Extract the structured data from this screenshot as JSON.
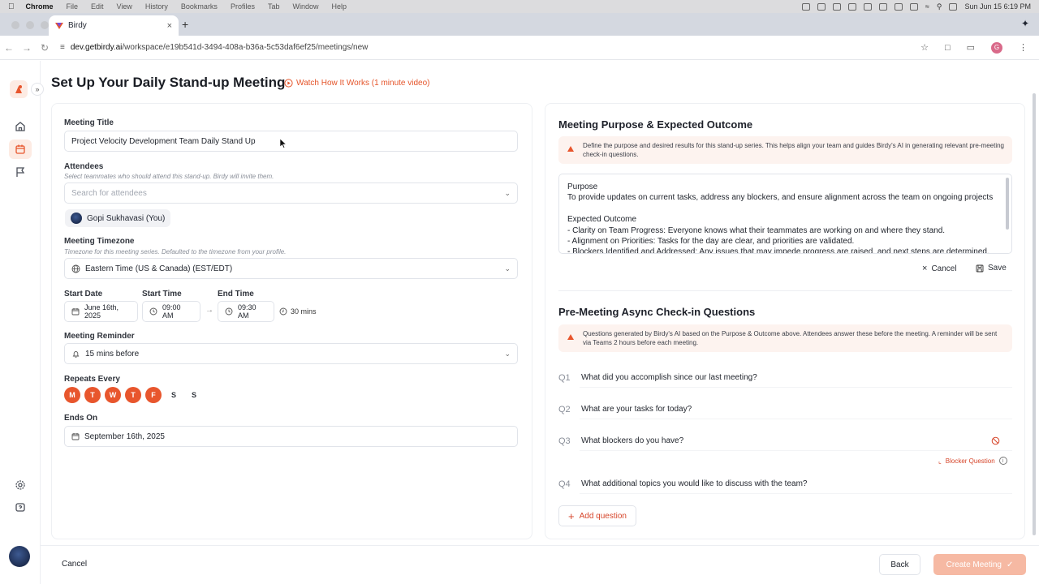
{
  "menubar": {
    "app": "Chrome",
    "items": [
      "File",
      "Edit",
      "View",
      "History",
      "Bookmarks",
      "Profiles",
      "Tab",
      "Window",
      "Help"
    ],
    "clock": "Sun Jun 15  6:19 PM"
  },
  "browser": {
    "tab_title": "Birdy",
    "url_host": "dev.getbirdy.ai",
    "url_path": "/workspace/e19b541d-3494-408a-b36a-5c53daf6ef25/meetings/new",
    "profile_initial": "G"
  },
  "page": {
    "title": "Set Up Your Daily Stand-up Meeting",
    "watch_link": "Watch How It Works (1 minute video)"
  },
  "form": {
    "meeting_title_label": "Meeting Title",
    "meeting_title_value": "Project Velocity Development Team Daily Stand Up",
    "attendees_label": "Attendees",
    "attendees_hint": "Select teammates who should attend this stand-up. Birdy will invite them.",
    "attendees_placeholder": "Search for attendees",
    "attendee_chip": "Gopi Sukhavasi (You)",
    "timezone_label": "Meeting Timezone",
    "timezone_hint": "Timezone for this meeting series. Defaulted to the timezone from your profile.",
    "timezone_value": "Eastern Time (US & Canada) (EST/EDT)",
    "start_date_label": "Start Date",
    "start_date_value": "June 16th, 2025",
    "start_time_label": "Start Time",
    "start_time_value": "09:00 AM",
    "end_time_label": "End Time",
    "end_time_value": "09:30 AM",
    "duration": "30 mins",
    "reminder_label": "Meeting Reminder",
    "reminder_value": "15 mins before",
    "repeats_label": "Repeats Every",
    "days": [
      "M",
      "T",
      "W",
      "T",
      "F",
      "S",
      "S"
    ],
    "days_selected": [
      true,
      true,
      true,
      true,
      true,
      false,
      false
    ],
    "ends_on_label": "Ends On",
    "ends_on_value": "September 16th, 2025"
  },
  "purpose": {
    "title": "Meeting Purpose & Expected Outcome",
    "note": "Define the purpose and desired results for this stand-up series. This helps align your team and guides Birdy's AI in generating relevant pre-meeting check-in questions.",
    "lines": [
      "Purpose",
      "To provide updates on current tasks, address any blockers, and ensure alignment across the team on ongoing projects",
      "",
      "Expected Outcome",
      "- Clarity on Team Progress: Everyone knows what their teammates are working on and where they stand.",
      "- Alignment on Priorities: Tasks for the day are clear, and priorities are validated.",
      "- Blockers Identified and Addressed: Any issues that may impede progress are raised, and next steps are determined."
    ],
    "cancel": "Cancel",
    "save": "Save"
  },
  "checkin": {
    "title": "Pre-Meeting Async Check-in Questions",
    "note": "Questions generated by Birdy's AI based on the Purpose & Outcome above. Attendees answer these before the meeting. A reminder will be sent via Teams 2 hours before each meeting.",
    "questions": [
      {
        "num": "Q1",
        "text": "What did you accomplish since our last meeting?"
      },
      {
        "num": "Q2",
        "text": "What are your tasks for today?"
      },
      {
        "num": "Q3",
        "text": "What blockers do you have?"
      },
      {
        "num": "Q4",
        "text": "What additional topics you would like to discuss with the team?"
      }
    ],
    "blocker_tag": "Blocker Question",
    "add_question": "Add question"
  },
  "footer": {
    "cancel": "Cancel",
    "back": "Back",
    "create": "Create Meeting"
  },
  "colors": {
    "accent": "#e8562d",
    "accent_soft": "#fdf3ef",
    "create_disabled": "#f6b9a3"
  }
}
